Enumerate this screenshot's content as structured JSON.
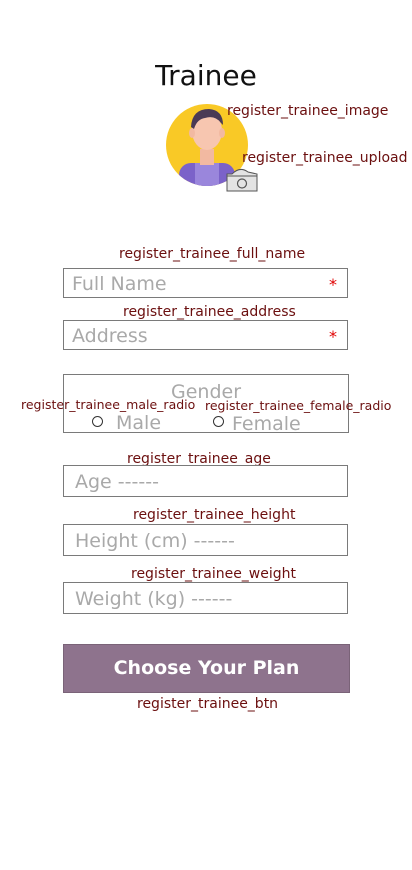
{
  "page": {
    "title": "Trainee"
  },
  "image": {
    "image_label": "register_trainee_image",
    "upload_label": "register_trainee_upload"
  },
  "full_name": {
    "id_label": "register_trainee_full_name",
    "placeholder": "Full Name",
    "required_mark": "*"
  },
  "address": {
    "id_label": "register_trainee_address",
    "placeholder": "Address",
    "required_mark": "*"
  },
  "gender": {
    "title": "Gender",
    "male_id_label": "register_trainee_male_radio",
    "male_label": "Male",
    "female_id_label": "register_trainee_female_radio",
    "female_label": "Female"
  },
  "age": {
    "id_label": "register_trainee_age",
    "placeholder": "Age ------"
  },
  "height": {
    "id_label": "register_trainee_height",
    "placeholder": "Height (cm) ------"
  },
  "weight": {
    "id_label": "register_trainee_weight",
    "placeholder": "Weight (kg) ------"
  },
  "submit": {
    "label": "Choose Your Plan",
    "id_label": "register_trainee_btn"
  },
  "colors": {
    "button_bg": "#8e738d",
    "label_text": "#6b0f0f",
    "required": "#e00000",
    "avatar_bg": "#f9c926",
    "avatar_shirt": "#7b62c9"
  },
  "icons": {
    "avatar": "avatar-icon",
    "camera": "camera-icon"
  }
}
